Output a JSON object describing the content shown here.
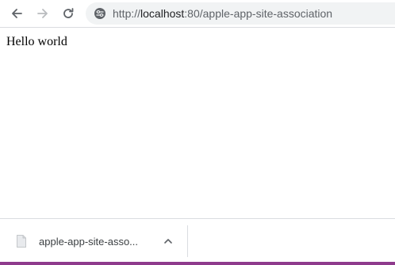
{
  "toolbar": {
    "back_icon": "arrow-left-icon",
    "forward_icon": "arrow-right-icon",
    "reload_icon": "reload-icon",
    "site_info_icon": "tune-icon",
    "url_scheme": "http://",
    "url_host": "localhost",
    "url_rest": ":80/apple-app-site-association"
  },
  "page": {
    "body_text": "Hello world"
  },
  "download_bar": {
    "file_icon": "file-icon",
    "file_name": "apple-app-site-asso...",
    "chevron_icon": "chevron-up-icon"
  },
  "colors": {
    "omnibox_bg": "#f1f3f4",
    "bottom_edge": "#8e3a8c"
  }
}
